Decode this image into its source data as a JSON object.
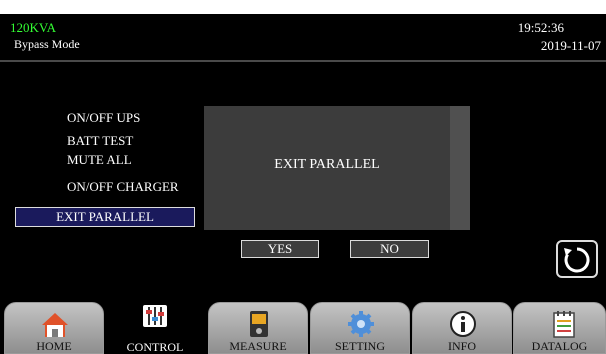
{
  "header": {
    "model": "120KVA",
    "mode": "Bypass Mode",
    "time": "19:52:36",
    "date": "2019-11-07"
  },
  "menu": {
    "items": [
      {
        "label": "ON/OFF UPS"
      },
      {
        "label": "BATT TEST"
      },
      {
        "label": "MUTE ALL"
      },
      {
        "label": "ON/OFF CHARGER"
      },
      {
        "label": "EXIT PARALLEL",
        "selected": true
      }
    ]
  },
  "dialog": {
    "message": "EXIT PARALLEL",
    "yes_label": "YES",
    "no_label": "NO"
  },
  "back_button": {
    "icon": "refresh-back-icon"
  },
  "tabs": [
    {
      "label": "HOME",
      "icon": "home-icon",
      "active": false
    },
    {
      "label": "CONTROL",
      "icon": "sliders-icon",
      "active": true
    },
    {
      "label": "MEASURE",
      "icon": "meter-icon",
      "active": false
    },
    {
      "label": "SETTING",
      "icon": "gear-icon",
      "active": false
    },
    {
      "label": "INFO",
      "icon": "info-icon",
      "active": false
    },
    {
      "label": "DATALOG",
      "icon": "notepad-icon",
      "active": false
    }
  ],
  "colors": {
    "background": "#000000",
    "model_text": "#33ff33",
    "selected_item": "#1a1a5c",
    "dialog": "#3c3c3c"
  }
}
